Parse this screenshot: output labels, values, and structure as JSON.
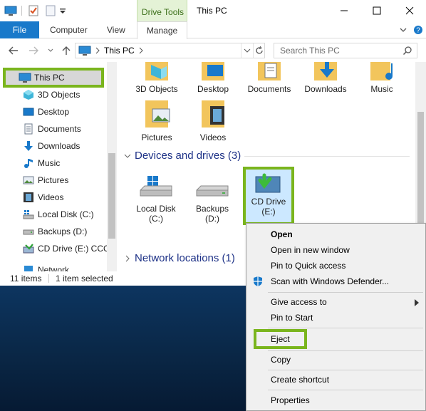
{
  "window": {
    "title": "This PC",
    "contextual_tab_group": "Drive Tools"
  },
  "ribbon": {
    "tabs": [
      "File",
      "Computer",
      "View",
      "Manage"
    ]
  },
  "address": {
    "path": "This PC",
    "search_placeholder": "Search This PC"
  },
  "navigation_pane": {
    "selected": "This PC",
    "items": [
      "3D Objects",
      "Desktop",
      "Documents",
      "Downloads",
      "Music",
      "Pictures",
      "Videos",
      "Local Disk (C:)",
      "Backups (D:)",
      "CD Drive (E:) CCC",
      "Network"
    ]
  },
  "content": {
    "folders": [
      "3D Objects",
      "Desktop",
      "Documents",
      "Downloads",
      "Music",
      "Pictures",
      "Videos"
    ],
    "devices_group": "Devices and drives (3)",
    "drives": [
      {
        "name": "Local Disk",
        "letter": "(C:)"
      },
      {
        "name": "Backups",
        "letter": "(D:)"
      },
      {
        "name": "CD Drive",
        "letter": "(E:)"
      }
    ],
    "network_group": "Network locations (1)"
  },
  "status_bar": {
    "item_count": "11 items",
    "selection": "1 item selected"
  },
  "context_menu": {
    "items": [
      "Open",
      "Open in new window",
      "Pin to Quick access",
      "Scan with Windows Defender...",
      "Give access to",
      "Pin to Start",
      "Eject",
      "Copy",
      "Create shortcut",
      "Properties"
    ]
  },
  "colors": {
    "accent": "#1979ca",
    "highlight_green": "#7ab51d",
    "group_header": "#1e3287",
    "selection": "#cce8ff"
  }
}
